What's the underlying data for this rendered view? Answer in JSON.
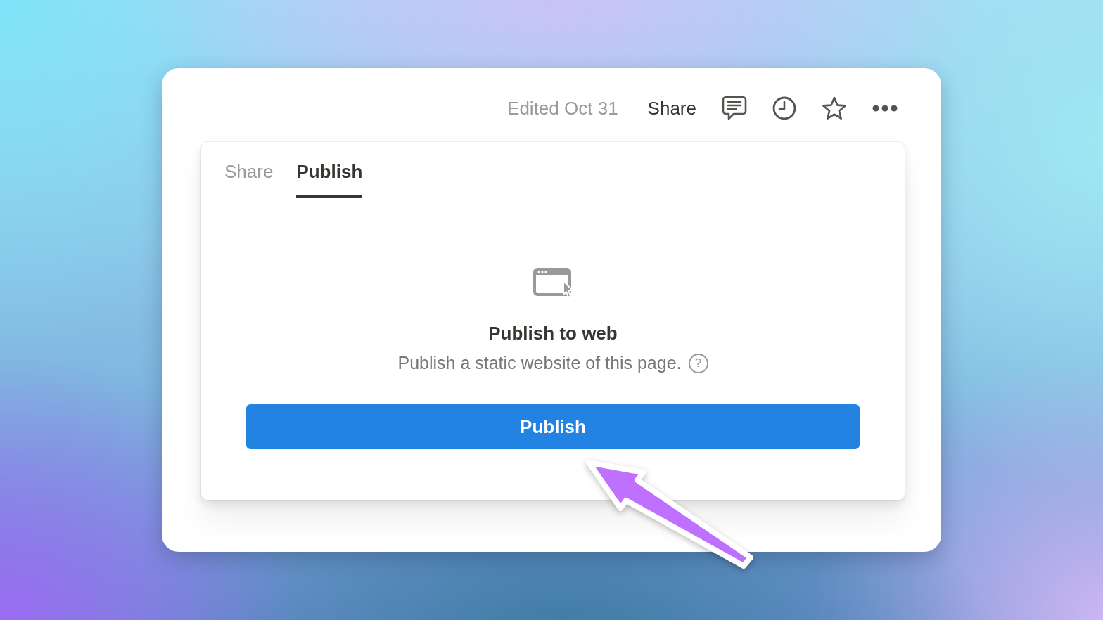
{
  "header": {
    "edited": "Edited Oct 31",
    "share_button": "Share"
  },
  "popover": {
    "tabs": [
      {
        "label": "Share",
        "selected": false
      },
      {
        "label": "Publish",
        "selected": true
      }
    ],
    "title": "Publish to web",
    "description": "Publish a static website of this page.",
    "help_icon": "?",
    "button": "Publish"
  }
}
